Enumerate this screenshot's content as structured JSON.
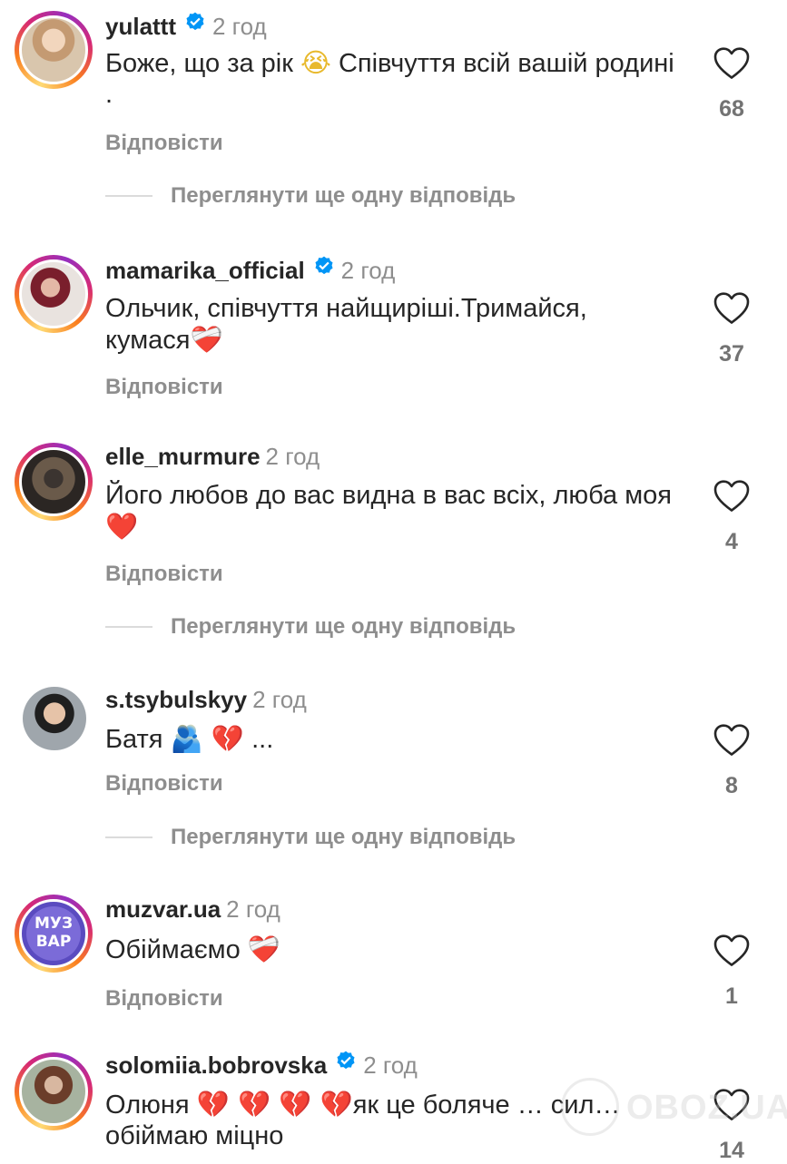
{
  "comments": [
    {
      "username": "yulattt",
      "verified": true,
      "time": "2 год",
      "text": "Боже, що за рік",
      "text_emoji": "😭",
      "text_after": "Співчуття всій вашій родині .",
      "likes": "68",
      "reply_label": "Відповісти",
      "more_replies": "Переглянути ще одну відповідь"
    },
    {
      "username": "mamarika_official",
      "verified": true,
      "time": "2 год",
      "text": "Ольчик, співчуття найщиріші.Тримайся, кумася",
      "text_emoji": "❤️‍🩹",
      "likes": "37",
      "reply_label": "Відповісти"
    },
    {
      "username": "elle_murmure",
      "verified": false,
      "time": "2 год",
      "text": "Його любов до вас видна в вас всіх, люба моя",
      "text_emoji": "❤️",
      "likes": "4",
      "reply_label": "Відповісти",
      "more_replies": "Переглянути ще одну відповідь"
    },
    {
      "username": "s.tsybulskyy",
      "verified": false,
      "time": "2 год",
      "text": "Батя",
      "text_emoji": "🫂 💔",
      "text_after": "...",
      "likes": "8",
      "reply_label": "Відповісти",
      "more_replies": "Переглянути ще одну відповідь"
    },
    {
      "username": "muzvar.ua",
      "verified": false,
      "time": "2 год",
      "avatar_text": "МУЗ ВАР",
      "text": "Обіймаємо",
      "text_emoji": "❤️‍🩹",
      "likes": "1",
      "reply_label": "Відповісти"
    },
    {
      "username": "solomiia.bobrovska",
      "verified": true,
      "time": "2 год",
      "text": "Олюня",
      "text_emoji": "💔 💔 💔 💔",
      "text_after": "як це боляче … сил… обіймаю міцно",
      "likes": "14",
      "reply_label": "Відповісти"
    }
  ],
  "watermark": "OBOZ.UA",
  "colors": {
    "text": "#262626",
    "muted": "#8e8e8e",
    "verified": "#0095f6",
    "story_ring": [
      "#feda75",
      "#fa7e1e",
      "#d62976",
      "#962fbf"
    ]
  },
  "icons": {
    "like": "heart-outline-icon",
    "verified": "verified-badge-icon"
  }
}
